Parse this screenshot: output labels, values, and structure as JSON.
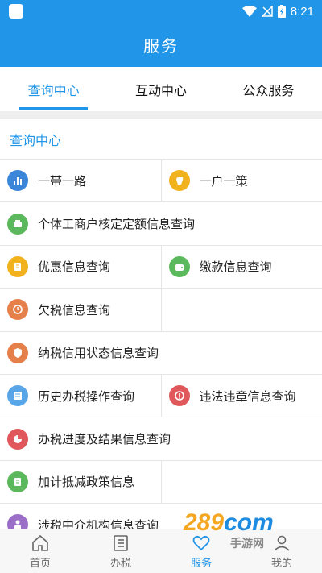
{
  "status_bar": {
    "time": "8:21"
  },
  "header": {
    "title": "服务"
  },
  "tabs": [
    {
      "label": "查询中心",
      "active": true
    },
    {
      "label": "互动中心",
      "active": false
    },
    {
      "label": "公众服务",
      "active": false
    }
  ],
  "section": {
    "title": "查询中心"
  },
  "items": {
    "belt_road": "一带一路",
    "one_policy": "一户一策",
    "self_employed": "个体工商户核定定额信息查询",
    "preferential": "优惠信息查询",
    "payment": "缴款信息查询",
    "arrears": "欠税信息查询",
    "credit_status": "纳税信用状态信息查询",
    "history": "历史办税操作查询",
    "violation": "违法违章信息查询",
    "progress": "办税进度及结果信息查询",
    "deduction": "加计抵减政策信息",
    "intermediary": "涉税中介机构信息查询"
  },
  "bottom_nav": [
    {
      "label": "首页",
      "icon": "home-icon",
      "active": false
    },
    {
      "label": "办税",
      "icon": "list-icon",
      "active": false
    },
    {
      "label": "服务",
      "icon": "heart-icon",
      "active": true
    },
    {
      "label": "我的",
      "icon": "user-icon",
      "active": false
    }
  ],
  "watermark": {
    "brand_a": "289",
    "brand_b": "com",
    "sub": "手游网"
  },
  "colors": {
    "primary": "#2196e8",
    "divider": "#e6e6e6"
  }
}
